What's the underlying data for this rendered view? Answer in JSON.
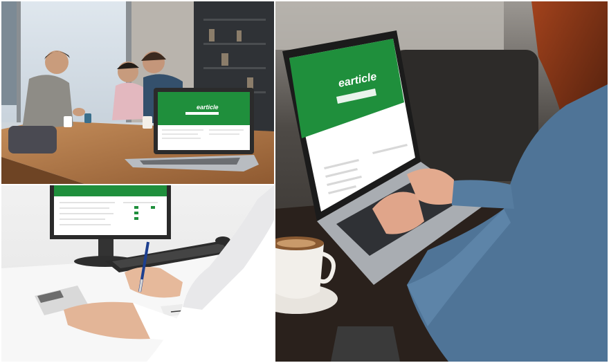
{
  "brand": {
    "logo_text": "earticle"
  },
  "colors": {
    "brand_green": "#1f8f3c",
    "wood": "#b07a4a",
    "desk_white": "#f3f3f3",
    "denim": "#4f7497",
    "cafe_dark": "#2a2623"
  },
  "panels": [
    {
      "scene": "students-at-wooden-table-with-laptop"
    },
    {
      "scene": "person-writing-at-desk-with-monitor-and-calculator"
    },
    {
      "scene": "person-typing-on-laptop-in-cafe-with-coffee"
    }
  ]
}
